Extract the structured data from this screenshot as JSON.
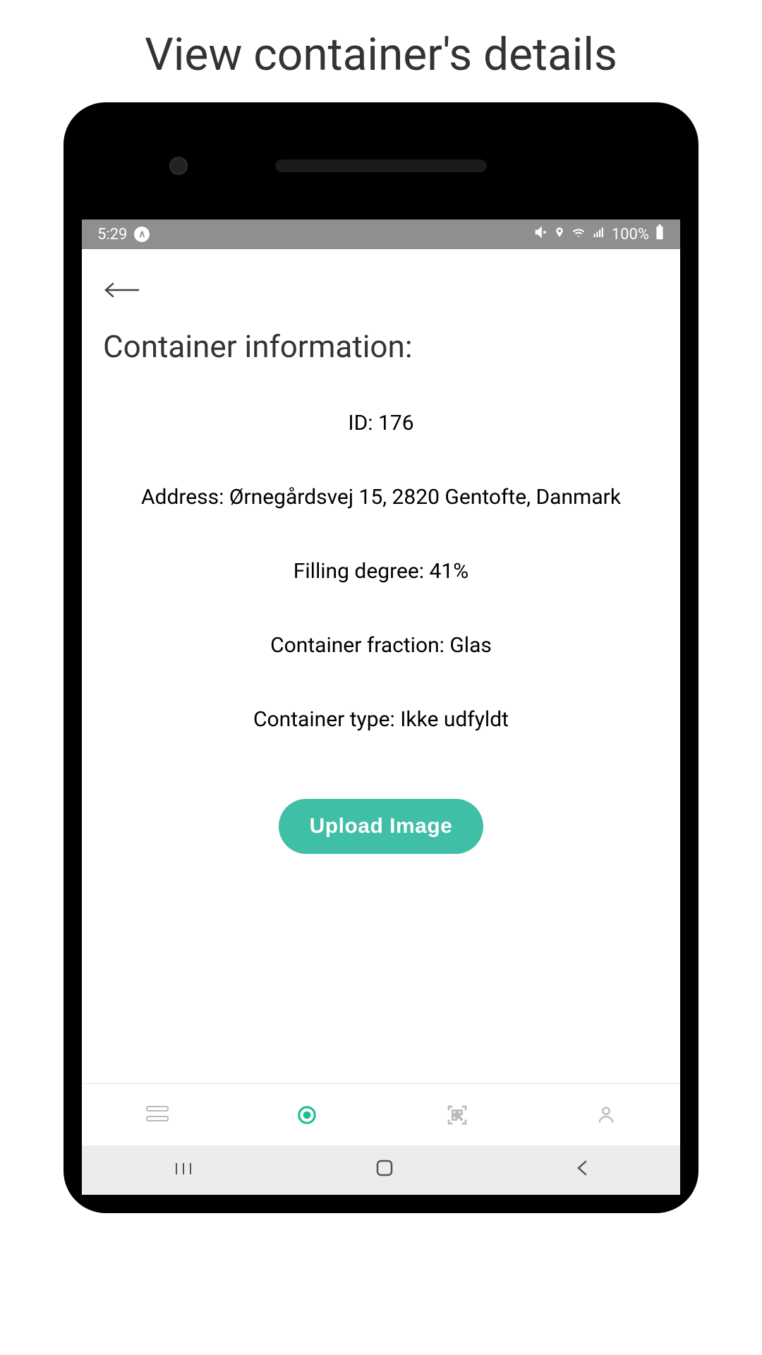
{
  "page": {
    "title": "View container's details"
  },
  "status_bar": {
    "time": "5:29",
    "battery": "100%"
  },
  "screen": {
    "heading": "Container information:",
    "fields": {
      "id_label": "ID:",
      "id_value": "176",
      "address_label": "Address:",
      "address_value": "Ørnegårdsvej 15, 2820 Gentofte, Danmark",
      "filling_label": "Filling degree:",
      "filling_value": "41%",
      "fraction_label": "Container fraction:",
      "fraction_value": "Glas",
      "type_label": "Container type:",
      "type_value": "Ikke udfyldt"
    },
    "upload_button": "Upload Image"
  },
  "nav": {
    "items": [
      "list",
      "location",
      "scan",
      "profile"
    ],
    "active": "location"
  }
}
